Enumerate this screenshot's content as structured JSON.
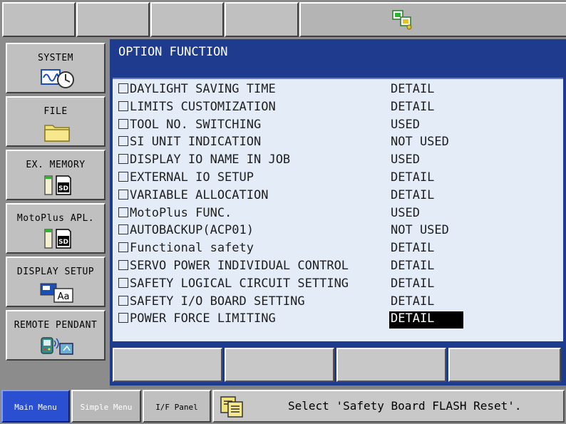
{
  "top_bar": {
    "status_icon": "multi-window-icon"
  },
  "left_menu": {
    "items": [
      {
        "label": "SYSTEM",
        "icon": "clock-waveform-icon"
      },
      {
        "label": "FILE",
        "icon": "folder-icon"
      },
      {
        "label": "EX. MEMORY",
        "icon": "sd-card-icon"
      },
      {
        "label": "MotoPlus APL.",
        "icon": "sd-card-icon"
      },
      {
        "label": "DISPLAY SETUP",
        "icon": "display-font-icon"
      },
      {
        "label": "REMOTE PENDANT",
        "icon": "remote-pendant-icon"
      }
    ]
  },
  "main": {
    "title": "OPTION FUNCTION",
    "options": [
      {
        "name": "DAYLIGHT SAVING TIME",
        "value": "DETAIL"
      },
      {
        "name": "LIMITS CUSTOMIZATION",
        "value": "DETAIL"
      },
      {
        "name": "TOOL NO. SWITCHING",
        "value": "USED"
      },
      {
        "name": "SI UNIT INDICATION",
        "value": "NOT USED"
      },
      {
        "name": "DISPLAY IO NAME IN JOB",
        "value": "USED"
      },
      {
        "name": "EXTERNAL IO SETUP",
        "value": "DETAIL"
      },
      {
        "name": "VARIABLE ALLOCATION",
        "value": "DETAIL"
      },
      {
        "name": "MotoPlus FUNC.",
        "value": "USED"
      },
      {
        "name": "AUTOBACKUP(ACP01)",
        "value": "NOT USED"
      },
      {
        "name": "Functional safety",
        "value": "DETAIL"
      },
      {
        "name": "SERVO POWER INDIVIDUAL CONTROL",
        "value": "DETAIL"
      },
      {
        "name": "SAFETY LOGICAL CIRCUIT SETTING",
        "value": "DETAIL"
      },
      {
        "name": "SAFETY I/O BOARD SETTING",
        "value": "DETAIL"
      },
      {
        "name": "POWER FORCE LIMITING",
        "value": "DETAIL",
        "selected": true
      }
    ]
  },
  "bottom_bar": {
    "main_menu": "Main Menu",
    "simple_menu": "Simple Menu",
    "if_panel": "I/F Panel",
    "message": "Select 'Safety Board FLASH Reset'.",
    "message_icon": "copy-pages-icon"
  },
  "colors": {
    "window_blue": "#1f3b8e",
    "content_bg": "#e4ecf8",
    "main_menu_active": "#2a4fd0",
    "selection_bg": "#000000"
  }
}
